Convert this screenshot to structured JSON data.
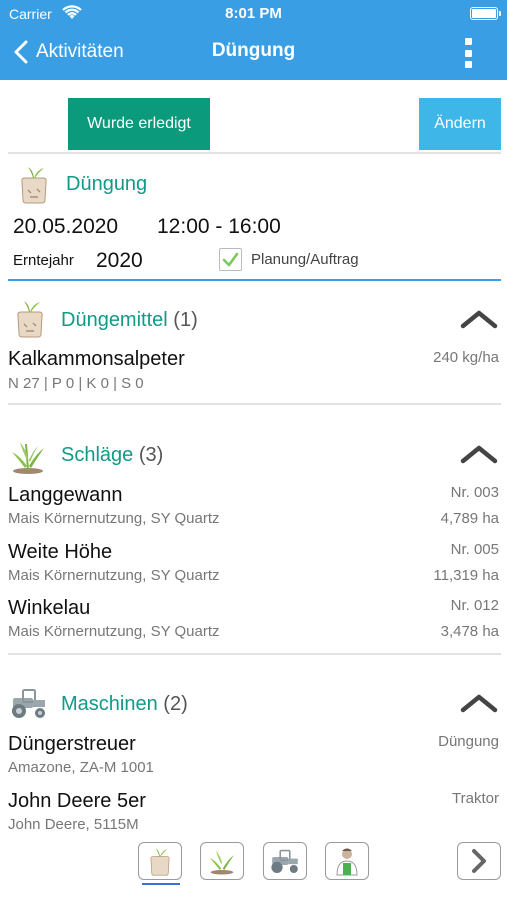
{
  "status": {
    "carrier": "Carrier",
    "time": "8:01 PM"
  },
  "nav": {
    "back_label": "Aktivitäten",
    "title": "Düngung"
  },
  "actions": {
    "done_label": "Wurde erledigt",
    "edit_label": "Ändern"
  },
  "header": {
    "title": "Düngung",
    "date": "20.05.2020",
    "time_range": "12:00 - 16:00",
    "erntejahr_label": "Erntejahr",
    "erntejahr_value": "2020",
    "planung_label": "Planung/Auftrag",
    "planung_checked": true
  },
  "duengemittel": {
    "title": "Düngemittel",
    "count": "(1)",
    "items": [
      {
        "name": "Kalkammonsalpeter",
        "detail": "N 27 | P 0 | K 0 | S 0",
        "amount": "240 kg/ha"
      }
    ]
  },
  "schlaege": {
    "title": "Schläge",
    "count": "(3)",
    "items": [
      {
        "name": "Langgewann",
        "detail": "Mais Körnernutzung, SY Quartz",
        "nr": "Nr. 003",
        "area": "4,789 ha"
      },
      {
        "name": "Weite Höhe",
        "detail": "Mais Körnernutzung, SY Quartz",
        "nr": "Nr. 005",
        "area": "11,319 ha"
      },
      {
        "name": "Winkelau",
        "detail": "Mais Körnernutzung, SY Quartz",
        "nr": "Nr. 012",
        "area": "3,478 ha"
      }
    ]
  },
  "maschinen": {
    "title": "Maschinen",
    "count": "(2)",
    "items": [
      {
        "name": "Düngerstreuer",
        "detail": "Amazone, ZA-M 1001",
        "type": "Düngung"
      },
      {
        "name": "John Deere 5er",
        "detail": "John Deere, 5115M",
        "type": "Traktor"
      }
    ]
  },
  "tabs": [
    {
      "icon": "fertilizer-bag-icon",
      "active": true
    },
    {
      "icon": "plant-icon",
      "active": false
    },
    {
      "icon": "tractor-icon",
      "active": false
    },
    {
      "icon": "worker-icon",
      "active": false
    },
    {
      "icon": "chevron-right-icon",
      "active": false
    }
  ],
  "colors": {
    "nav_blue": "#3a9ee4",
    "done_green": "#0c9a7d",
    "edit_blue": "#3eb6e8",
    "section_teal": "#119a87"
  }
}
